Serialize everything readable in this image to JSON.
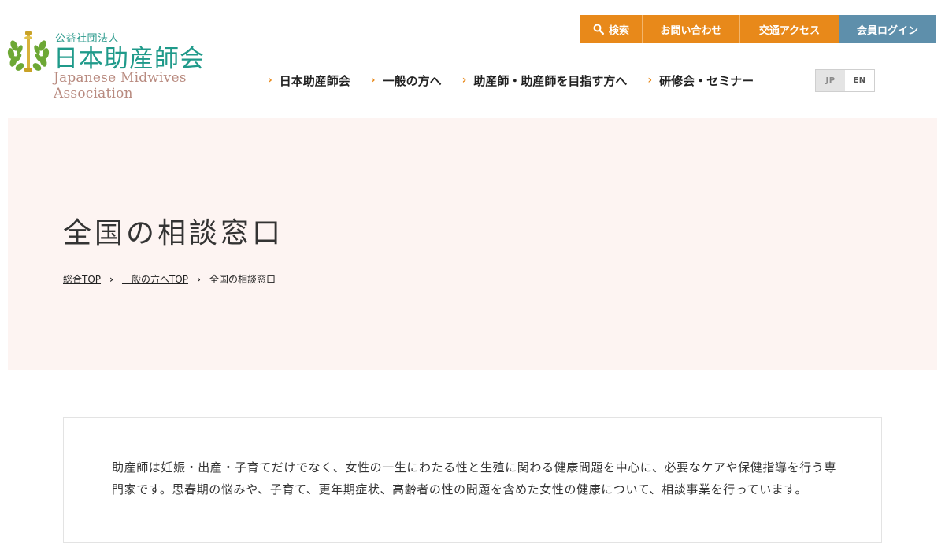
{
  "logo": {
    "sub": "公益社団法人",
    "main": "日本助産師会",
    "en": "Japanese Midwives Association"
  },
  "utility": {
    "search": "検索",
    "contact": "お問い合わせ",
    "access": "交通アクセス",
    "login": "会員ログイン"
  },
  "nav": [
    {
      "label": "日本助産師会"
    },
    {
      "label": "一般の方へ"
    },
    {
      "label": "助産師・助産師を目指す方へ"
    },
    {
      "label": "研修会・セミナー"
    }
  ],
  "lang": {
    "jp": "JP",
    "en": "EN"
  },
  "hero": {
    "title": "全国の相談窓口",
    "breadcrumb": [
      "総合TOP",
      "一般の方へTOP",
      "全国の相談窓口"
    ],
    "separator": "›"
  },
  "content": {
    "intro": "助産師は妊娠・出産・子育てだけでなく、女性の一生にわたる性と生殖に関わる健康問題を中心に、必要なケアや保健指導を行う専門家です。思春期の悩みや、子育て、更年期症状、高齢者の性の問題を含めた女性の健康について、相談事業を行っています。"
  },
  "colors": {
    "orange": "#e8891a",
    "login_blue": "#5e8fab",
    "hero_bg": "#fdf4f2",
    "logo_teal": "#1f9a8a"
  }
}
